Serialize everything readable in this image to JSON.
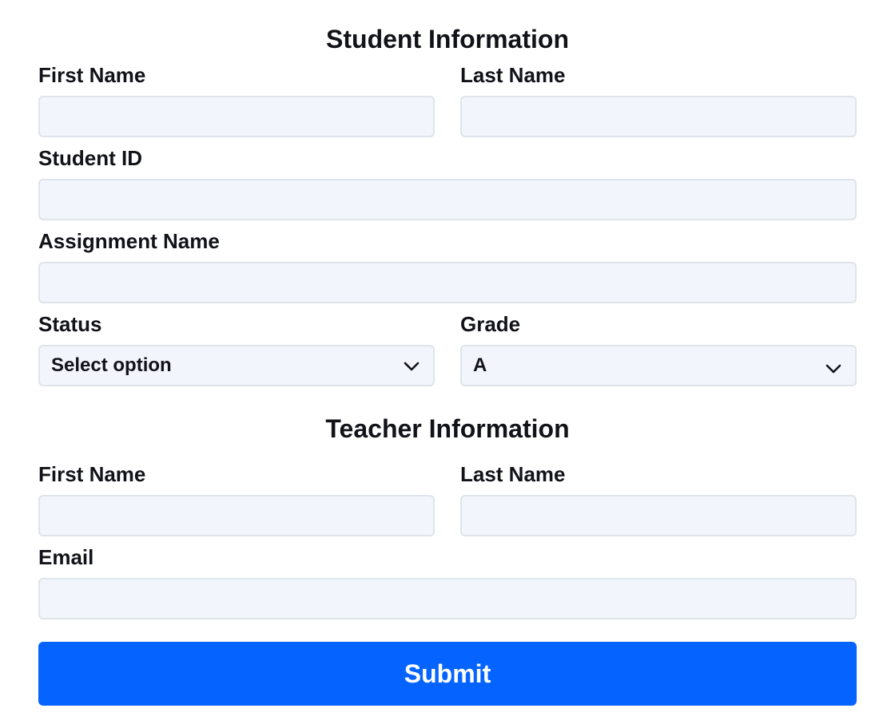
{
  "student": {
    "title": "Student Information",
    "first_name_label": "First Name",
    "last_name_label": "Last Name",
    "student_id_label": "Student ID",
    "assignment_label": "Assignment Name",
    "status_label": "Status",
    "status_value": "Select option",
    "grade_label": "Grade",
    "grade_value": "A"
  },
  "teacher": {
    "title": "Teacher Information",
    "first_name_label": "First Name",
    "last_name_label": "Last Name",
    "email_label": "Email"
  },
  "submit_label": "Submit",
  "colors": {
    "accent": "#0564ff",
    "field_bg": "#f2f5fc",
    "field_border": "#dfe3ea"
  }
}
